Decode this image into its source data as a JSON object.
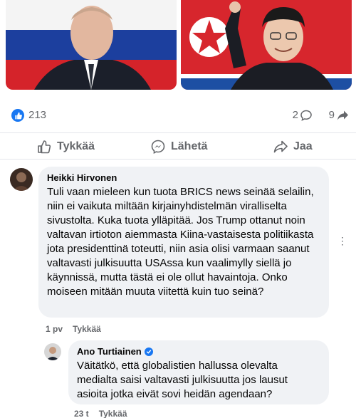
{
  "post": {
    "reactions": {
      "like_count": "213"
    },
    "comments_count": "2",
    "shares_count": "9",
    "colors": {
      "accent": "#1877f2",
      "muted": "#65676b",
      "bubble": "#f0f2f5"
    }
  },
  "actions": {
    "like": "Tykkää",
    "send": "Lähetä",
    "share": "Jaa"
  },
  "comments": [
    {
      "author": "Heikki Hirvonen",
      "text": "Tuli vaan mieleen kun tuota BRICS news seinää selailin, niin ei vaikuta miltään kirjainyhdistelmän viralliselta sivustolta. Kuka tuota ylläpitää. Jos Trump ottanut noin valtavan irtioton aiemmasta Kiina-vastaisesta politiikasta jota presidenttinä toteutti, niin asia olisi varmaan saanut valtavasti julkisuutta USAssa kun vaalimylly siellä jo käynnissä, mutta tästä ei ole ollut havaintoja. Onko moiseen mitään muuta viitettä kuin tuo seinä?",
      "time": "1 pv",
      "like_label": "Tykkää"
    },
    {
      "author": "Ano Turtiainen",
      "verified": true,
      "text": "Väitätkö, että globalistien hallussa olevalta medialta saisi valtavasti julkisuutta jos lausut asioita jotka eivät sovi heidän agendaan?",
      "time": "23 t",
      "like_label": "Tykkää"
    }
  ],
  "icons": {
    "like_badge": "thumbs-up-icon",
    "comment": "comment-icon",
    "share": "share-arrow-icon",
    "send": "messenger-icon",
    "more": "more-options-icon"
  },
  "more_symbol": "⋮"
}
